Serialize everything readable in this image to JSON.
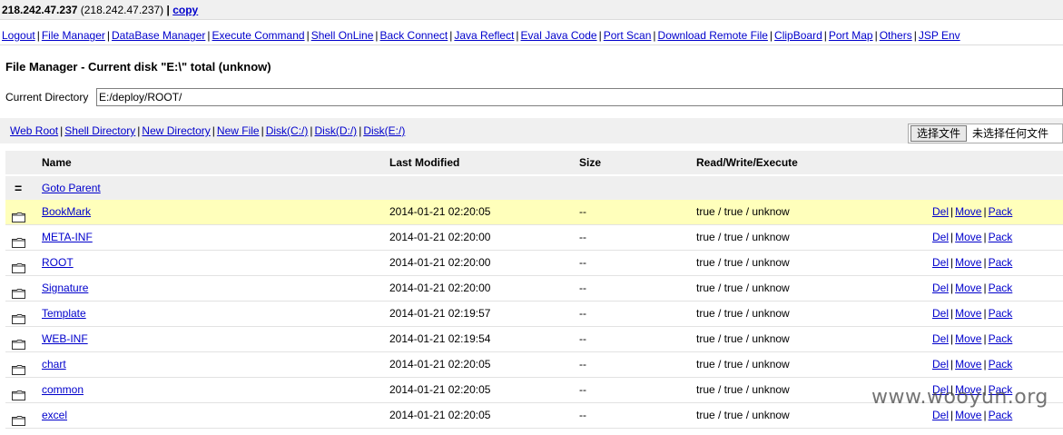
{
  "topbar": {
    "ip": "218.242.47.237",
    "ip_paren": "(218.242.47.237)",
    "sep": "|",
    "copy": "copy"
  },
  "menu": [
    "Logout",
    "File Manager",
    "DataBase Manager",
    "Execute Command",
    "Shell OnLine",
    "Back Connect",
    "Java Reflect",
    "Eval Java Code",
    "Port Scan",
    "Download Remote File",
    "ClipBoard",
    "Port Map",
    "Others",
    "JSP Env"
  ],
  "page": {
    "title": "File Manager - Current disk \"E:\\\" total (unknow)",
    "current_dir_label": "Current Directory",
    "current_dir_value": "E:/deploy/ROOT/"
  },
  "quick_links": [
    "Web Root",
    "Shell Directory",
    "New Directory",
    "New File",
    "Disk(C:/)",
    "Disk(D:/)",
    "Disk(E:/)"
  ],
  "upload": {
    "button": "选择文件",
    "status": "未选择任何文件"
  },
  "table": {
    "headers": {
      "name": "Name",
      "modified": "Last Modified",
      "size": "Size",
      "rwx": "Read/Write/Execute"
    },
    "parent": {
      "icon": "=",
      "label": "Goto Parent"
    },
    "actions": {
      "del": "Del",
      "move": "Move",
      "pack": "Pack"
    },
    "rows": [
      {
        "name": "BookMark",
        "modified": "2014-01-21 02:20:05",
        "size": "--",
        "rwx": "true / true / unknow"
      },
      {
        "name": "META-INF",
        "modified": "2014-01-21 02:20:00",
        "size": "--",
        "rwx": "true / true / unknow"
      },
      {
        "name": "ROOT",
        "modified": "2014-01-21 02:20:00",
        "size": "--",
        "rwx": "true / true / unknow"
      },
      {
        "name": "Signature",
        "modified": "2014-01-21 02:20:00",
        "size": "--",
        "rwx": "true / true / unknow"
      },
      {
        "name": "Template",
        "modified": "2014-01-21 02:19:57",
        "size": "--",
        "rwx": "true / true / unknow"
      },
      {
        "name": "WEB-INF",
        "modified": "2014-01-21 02:19:54",
        "size": "--",
        "rwx": "true / true / unknow"
      },
      {
        "name": "chart",
        "modified": "2014-01-21 02:20:05",
        "size": "--",
        "rwx": "true / true / unknow"
      },
      {
        "name": "common",
        "modified": "2014-01-21 02:20:05",
        "size": "--",
        "rwx": "true / true / unknow"
      },
      {
        "name": "excel",
        "modified": "2014-01-21 02:20:05",
        "size": "--",
        "rwx": "true / true / unknow"
      }
    ]
  },
  "watermark": "www.wooyun.org",
  "colors": {
    "highlight_row": "#ffffbb",
    "link": "#0000cc",
    "header_bg": "#efefef"
  }
}
